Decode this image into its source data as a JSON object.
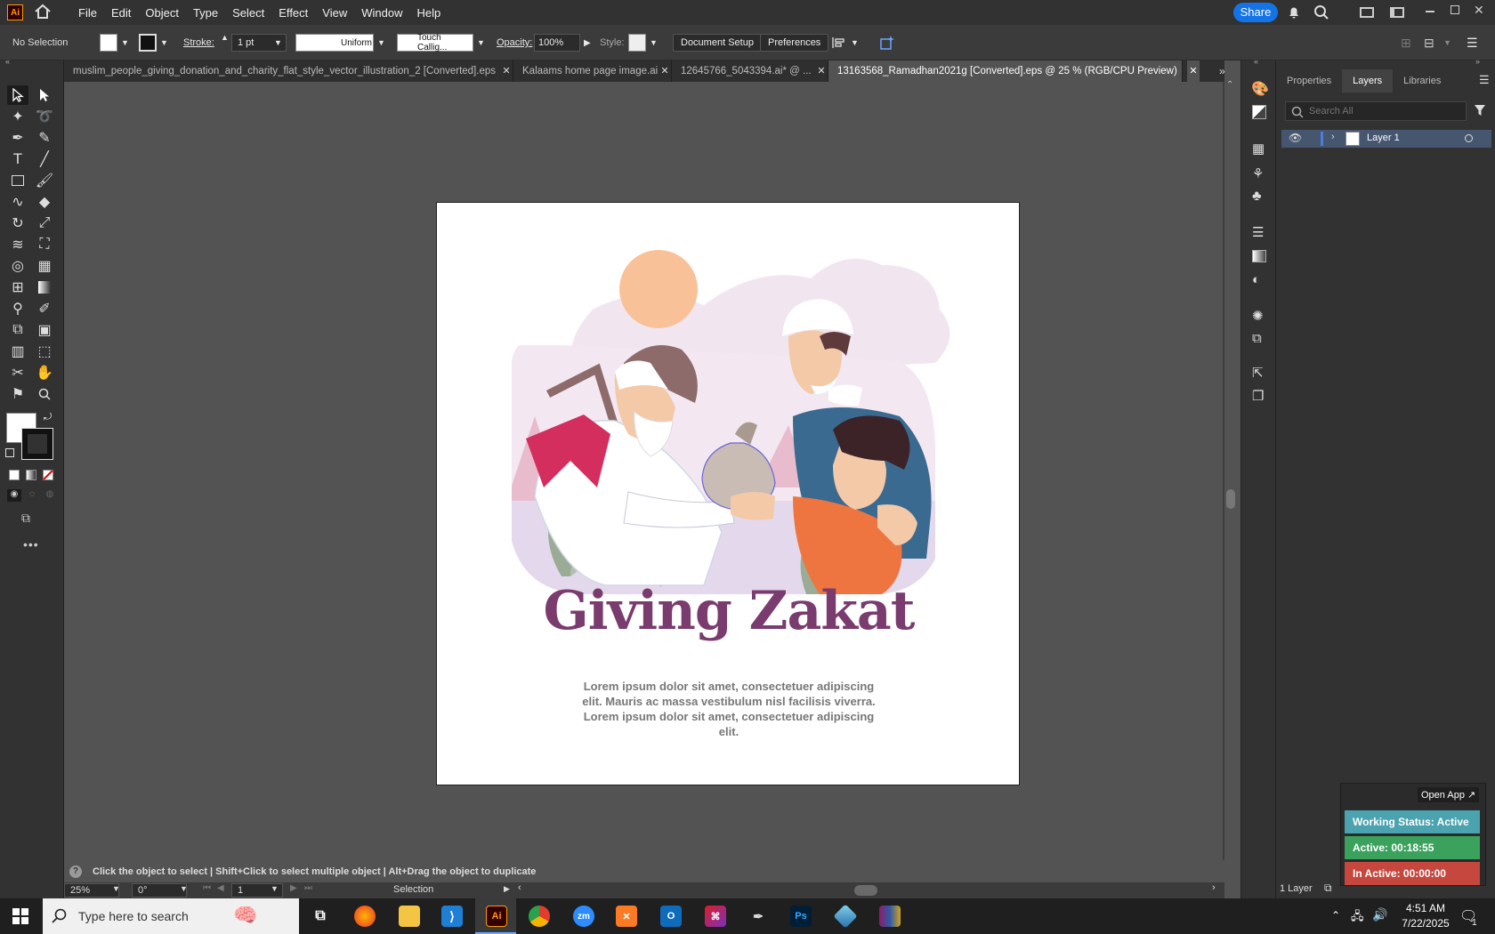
{
  "app": {
    "logo": "Ai"
  },
  "menu": [
    "File",
    "Edit",
    "Object",
    "Type",
    "Select",
    "Effect",
    "View",
    "Window",
    "Help"
  ],
  "share_label": "Share",
  "control": {
    "selection": "No Selection",
    "stroke_label": "Stroke:",
    "stroke_value": "1 pt",
    "profile": "Uniform",
    "brush": "Touch Callig...",
    "opacity_label": "Opacity:",
    "opacity_value": "100%",
    "style_label": "Style:",
    "document_setup": "Document Setup",
    "preferences": "Preferences"
  },
  "tabs": [
    {
      "label": "muslim_people_giving_donation_and_charity_flat_style_vector_illustration_2 [Converted].eps"
    },
    {
      "label": "Kalaams home page image.ai"
    },
    {
      "label": "12645766_5043394.ai* @ ..."
    },
    {
      "label": "13163568_Ramadhan2021g [Converted].eps @ 25 % (RGB/CPU Preview)"
    }
  ],
  "artwork": {
    "title": "Giving Zakat",
    "body": "Lorem ipsum dolor sit amet, consectetuer adipiscing elit. Mauris ac massa vestibulum nisl facilisis viverra. Lorem ipsum dolor sit amet, consectetuer adipiscing elit.",
    "colors": {
      "title": "#7a3b6e",
      "sun": "#f9c197",
      "magenta": "#d42e5f",
      "orange": "#ee7440",
      "blue": "#3a6a90",
      "leaf": "#9aab96"
    }
  },
  "status": {
    "hint": "Click the object to select  |  Shift+Click to select multiple object  |  Alt+Drag the object to duplicate",
    "zoom": "25%",
    "rotation": "0°",
    "artboard": "1",
    "tool": "Selection"
  },
  "panel": {
    "tabs": [
      "Properties",
      "Layers",
      "Libraries"
    ],
    "active_tab": "Layers",
    "search_placeholder": "Search All",
    "layer_name": "Layer 1",
    "layer_count": "1 Layer"
  },
  "timer": {
    "open_app": "Open App",
    "working_status": "Working Status: Active",
    "active": "Active: 00:18:55",
    "inactive": "In Active: 00:00:00",
    "colors": {
      "status": "#4ba3b0",
      "active": "#3aa25c",
      "inactive": "#c6473d"
    }
  },
  "taskbar": {
    "search_placeholder": "Type here to search",
    "time": "4:51 AM",
    "date": "7/22/2025",
    "notifications": "1"
  }
}
